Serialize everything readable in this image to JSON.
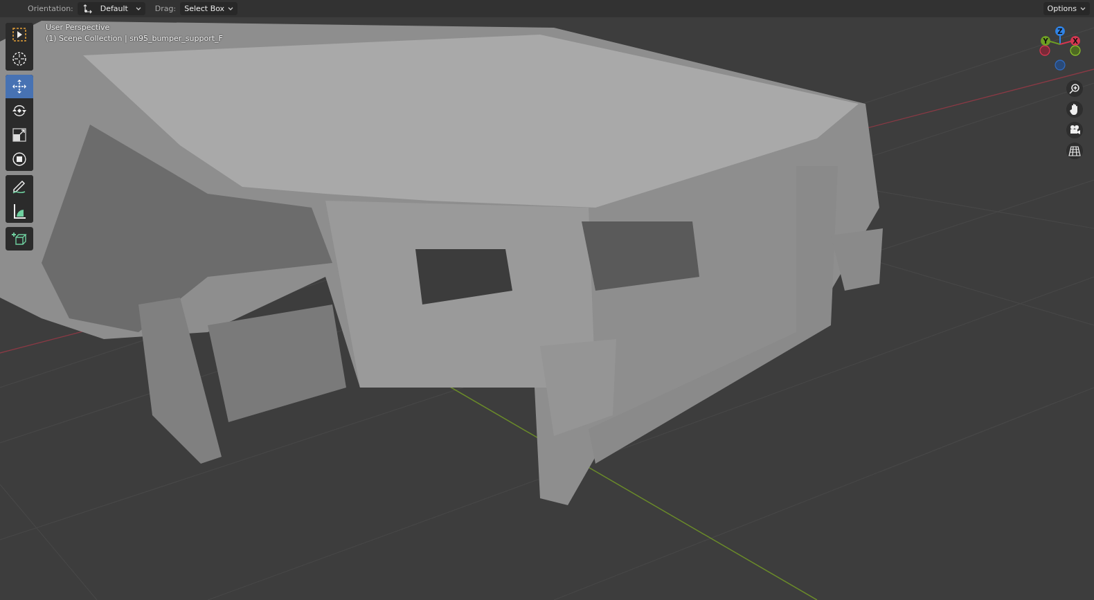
{
  "header": {
    "orientation_label": "Orientation:",
    "orientation_value": "Default",
    "drag_label": "Drag:",
    "drag_value": "Select Box",
    "options": "Options"
  },
  "viewport_info": [
    "User Perspective",
    "(1) Scene Collection | sn95_bumper_support_F"
  ],
  "tool_groups": [
    {
      "tools": [
        {
          "kind": "select_box",
          "selected": false
        },
        {
          "kind": "cursor",
          "selected": false
        }
      ]
    },
    {
      "tools": [
        {
          "kind": "move",
          "selected": true
        },
        {
          "kind": "rotate",
          "selected": false
        },
        {
          "kind": "scale",
          "selected": false
        },
        {
          "kind": "transform",
          "selected": false
        }
      ]
    },
    {
      "tools": [
        {
          "kind": "annotate",
          "selected": false
        },
        {
          "kind": "measure",
          "selected": false
        }
      ]
    },
    {
      "tools": [
        {
          "kind": "add_cube",
          "selected": false
        }
      ]
    }
  ],
  "gizmo_axes": [
    {
      "label": "Z",
      "color": "#2f83e6"
    },
    {
      "label": "Y",
      "color": "#6ea023"
    },
    {
      "label": "X",
      "color": "#d63650"
    }
  ],
  "nav_buttons": [
    {
      "kind": "zoom"
    },
    {
      "kind": "pan"
    },
    {
      "kind": "camera"
    },
    {
      "kind": "ortho"
    }
  ]
}
